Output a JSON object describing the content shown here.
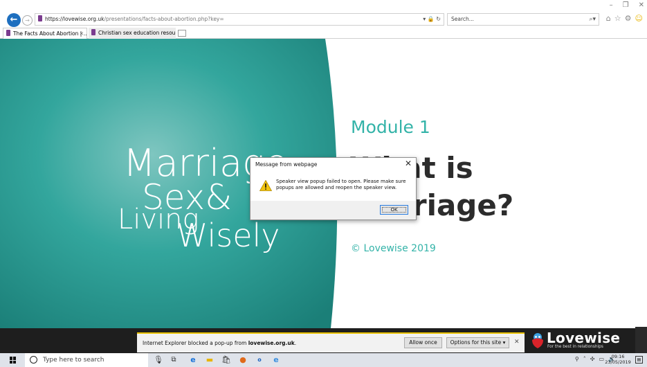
{
  "browser": {
    "url_host": "https://lovewise.org.uk",
    "url_path": "/presentations/facts-about-abortion.php?key=",
    "url_right_icons": "▾ 🔒 ↻",
    "search_placeholder": "Search...",
    "tabs": [
      {
        "label": "The Facts About Abortion | ...",
        "active": true
      },
      {
        "label": "Christian sex education resour...",
        "active": false
      }
    ]
  },
  "slide": {
    "logo_words": [
      "Marriage",
      "Sex&",
      "Living",
      "Wisely"
    ],
    "module": "Module 1",
    "headline_line1": "What is",
    "headline_line2": "Marriage?",
    "copyright": "© Lovewise 2019",
    "colors": {
      "teal": "#2fa59c",
      "accent": "#33b3a8",
      "heading": "#2c2c2c"
    }
  },
  "dialog": {
    "title": "Message from webpage",
    "message": "Speaker view popup failed to open. Please make sure popups are allowed and reopen the speaker view.",
    "ok_label": "OK"
  },
  "notification": {
    "text_prefix": "Internet Explorer blocked a pop-up from ",
    "domain": "lovewise.org.uk",
    "text_suffix": ".",
    "allow_label": "Allow once",
    "options_label": "Options for this site ▾"
  },
  "brand": {
    "name": "Lovewise",
    "tagline": "For the best in relationships"
  },
  "taskbar": {
    "search_placeholder": "Type here to search",
    "time": "09:16",
    "date": "23/05/2019"
  }
}
